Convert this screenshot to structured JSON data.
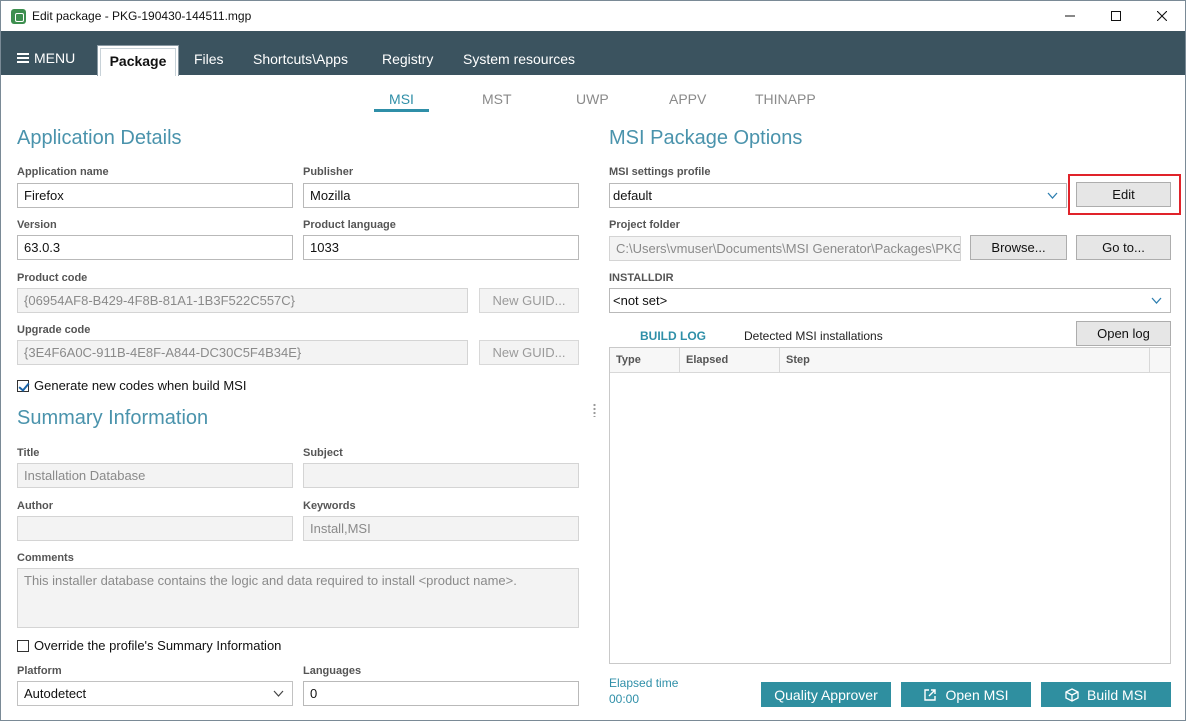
{
  "window": {
    "title": "Edit package - PKG-190430-144511.mgp"
  },
  "ribbon": {
    "menu_label": "MENU",
    "tabs": [
      "Package",
      "Files",
      "Shortcuts\\Apps",
      "Registry",
      "System resources"
    ]
  },
  "subtabs": [
    "MSI",
    "MST",
    "UWP",
    "APPV",
    "THINAPP"
  ],
  "app_details": {
    "heading": "Application Details",
    "app_name_label": "Application name",
    "app_name": "Firefox",
    "publisher_label": "Publisher",
    "publisher": "Mozilla",
    "version_label": "Version",
    "version": "63.0.3",
    "language_label": "Product language",
    "language": "1033",
    "product_code_label": "Product code",
    "product_code": "{06954AF8-B429-4F8B-81A1-1B3F522C557C}",
    "new_guid_label": "New GUID...",
    "upgrade_code_label": "Upgrade code",
    "upgrade_code": "{3E4F6A0C-911B-4E8F-A844-DC30C5F4B34E}",
    "generate_label": "Generate new codes when build MSI",
    "generate_checked": true
  },
  "summary": {
    "heading": "Summary Information",
    "title_label": "Title",
    "title": "Installation Database",
    "subject_label": "Subject",
    "subject": "",
    "author_label": "Author",
    "author": "",
    "keywords_label": "Keywords",
    "keywords": "Install,MSI",
    "comments_label": "Comments",
    "comments": "This installer database contains the logic and data required to install <product name>.",
    "override_label": "Override the profile's Summary Information",
    "override_checked": false,
    "platform_label": "Platform",
    "platform": "Autodetect",
    "languages_label": "Languages",
    "languages": "0"
  },
  "msi_options": {
    "heading": "MSI Package Options",
    "profile_label": "MSI settings profile",
    "profile": "default",
    "edit_label": "Edit",
    "project_folder_label": "Project folder",
    "project_folder": "C:\\Users\\vmuser\\Documents\\MSI Generator\\Packages\\PKG",
    "browse_label": "Browse...",
    "goto_label": "Go to...",
    "installdir_label": "INSTALLDIR",
    "installdir": "<not set>"
  },
  "log": {
    "build_log_tab": "BUILD LOG",
    "detected_tab": "Detected MSI installations",
    "open_log_label": "Open log",
    "columns": [
      "Type",
      "Elapsed",
      "Step"
    ]
  },
  "footer": {
    "elapsed_label": "Elapsed time",
    "elapsed_value": "00:00",
    "quality_label": "Quality Approver",
    "open_msi_label": "Open MSI",
    "build_msi_label": "Build MSI"
  },
  "colors": {
    "accent": "#2f8fa0",
    "ribbon": "#3b535f",
    "heading": "#4a93ac",
    "highlight": "#e0232a"
  }
}
